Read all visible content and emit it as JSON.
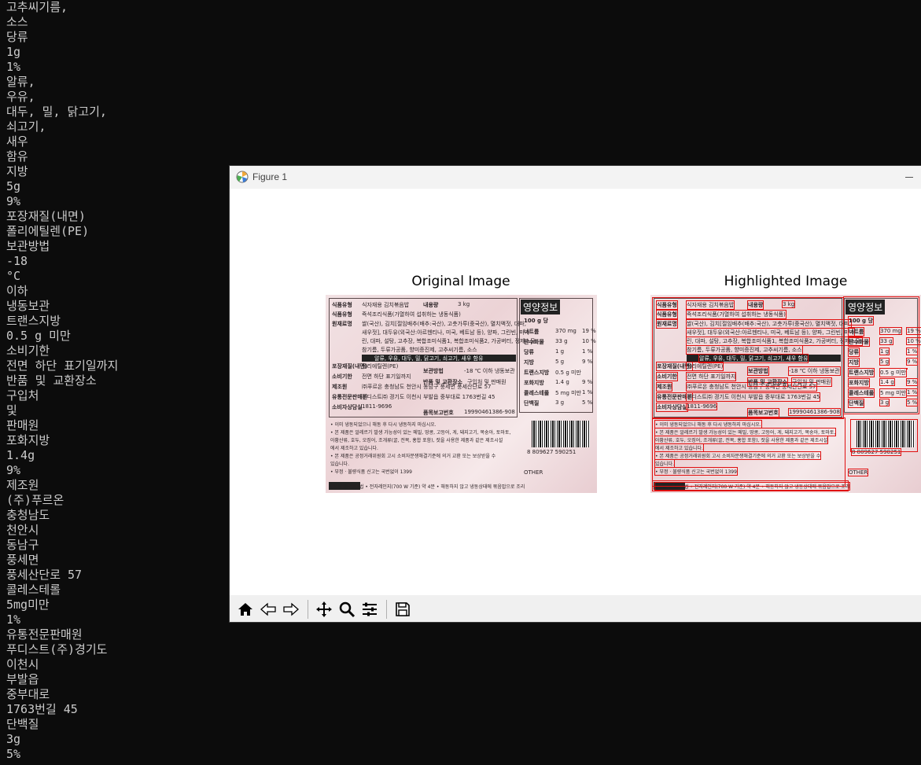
{
  "terminal": {
    "lines": [
      "고추씨기름,",
      "소스",
      "당류",
      "1g",
      "1%",
      "알류,",
      "우유,",
      "대두, 밀, 닭고기,",
      "쇠고기,",
      "새우",
      "함유",
      "지방",
      "5g",
      "9%",
      "포장재질(내면)",
      "폴리에틸렌(PE)",
      "보관방법",
      "-18",
      "°C",
      "이하",
      "냉동보관",
      "트랜스지방",
      "0.5 g 미만",
      "소비기한",
      "전면 하단 표기일까지",
      "반품 및 교환장소",
      "구입처",
      "및",
      "판매원",
      "포화지방",
      "1.4g",
      "9%",
      "제조원",
      "(주)푸르온",
      "충청남도",
      "천안시",
      "동남구",
      "풍세면",
      "풍세산단로 57",
      "콜레스테롤",
      "5mg미만",
      "1%",
      "유통전문판매원",
      "푸디스트(주)경기도",
      "이천시",
      "부발읍",
      "중부대로",
      "1763번길 45",
      "단백질",
      "3g",
      "5%"
    ]
  },
  "window": {
    "title": "Figure 1",
    "app_icon": "matplotlib-icon"
  },
  "figure": {
    "original_title": "Original Image",
    "highlighted_title": "Highlighted Image",
    "label": {
      "nutrition_title": "영양정보",
      "per_100g": "100 g 당",
      "rows": [
        {
          "k": "식품유형",
          "v": "식자재용 김치볶음밥"
        },
        {
          "k": "식품유형",
          "v": "즉석조리식품(가열하여 섭취하는 냉동식품)"
        },
        {
          "k": "원재료명",
          "v": "쌀(국산), 김치[절임배추(배추:국산), 고춧가루(중국산), 멸치액젓, 대파,"
        },
        {
          "k": "",
          "v": "새우젓], 대두유(외국산:아르헨티나, 미국, 베트남 등), 양파, 그린빈, 마가"
        },
        {
          "k": "",
          "v": "린, 대파, 설탕, 고추장, 복합조미식품1, 복합조미식품2, 가공버터, 정제소금,"
        },
        {
          "k": "",
          "v": "참기름, 두류가공품, 향미증진제, 고추씨기름, 소스"
        },
        {
          "k": "포장재질(내면)",
          "v": "폴리에틸렌(PE)"
        },
        {
          "k": "소비기한",
          "v": "전면 하단 표기일까지"
        },
        {
          "k": "제조원",
          "v": "㈜푸르온 충청남도 천안시 동남구 풍세면 풍세산단로 57"
        },
        {
          "k": "유통전문판매원",
          "v": "푸디스트㈜ 경기도 이천시 부발읍 중부대로 1763번길 45"
        },
        {
          "k": "소비자상담실",
          "v": "1811-9696"
        }
      ],
      "allergen": "알류, 우유, 대두, 밀, 닭고기, 쇠고기, 새우 함유",
      "storage_k": "보관방법",
      "storage_v": "-18 ℃ 이하 냉동보관",
      "return_k": "반품 및 교환장소",
      "return_v": "구입처 및 판매원",
      "weight_k": "내용량",
      "weight_v": "3 kg",
      "report_k": "품목보고번호",
      "report_v": "19990461386-908",
      "notes": [
        "• 이미 냉동되었으니 해동 후 다시 냉동하지 마십시오.",
        "• 본 제품은 알레르기 발생 가능성이 있는 메밀, 땅콩, 고등어, 게, 돼지고기, 복숭아, 토마토,",
        "  아황산류, 호두, 오징어, 조개류(굴, 전복, 홍합 포함), 잣을 사용한 제품과 같은 제조시설",
        "  에서 제조하고 있습니다.",
        "• 본 제품은 공정거래위원회 고시 소비자분쟁해결기준에 의거 교환 또는 보상받을 수",
        "  있습니다.",
        "• 부정 · 불량식품 신고는 국번없이 1399"
      ],
      "cooking": "해동 및 조리방법 • 전자레인지(700 W 기준) 약 4분 • 해동하지 않고 냉동상태에 볶음밥으로 조리",
      "nutrients": [
        {
          "k": "나트륨",
          "v": "370 mg",
          "p": "19 %"
        },
        {
          "k": "탄수화물",
          "v": "33 g",
          "p": "10 %"
        },
        {
          "k": "당류",
          "v": "1 g",
          "p": "1 %"
        },
        {
          "k": "지방",
          "v": "5 g",
          "p": "9 %"
        },
        {
          "k": "트랜스지방",
          "v": "0.5 g 미만",
          "p": ""
        },
        {
          "k": "포화지방",
          "v": "1.4 g",
          "p": "9 %"
        },
        {
          "k": "콜레스테롤",
          "v": "5 mg 미만",
          "p": "1 %"
        },
        {
          "k": "단백질",
          "v": "3 g",
          "p": "5 %"
        }
      ],
      "barcode": "8 809627 590251",
      "recycle": "OTHER"
    }
  },
  "toolbar": {
    "buttons": [
      {
        "name": "home-button",
        "icon": "home-icon"
      },
      {
        "name": "back-button",
        "icon": "back-arrow-icon"
      },
      {
        "name": "forward-button",
        "icon": "forward-arrow-icon"
      },
      {
        "name": "pan-button",
        "icon": "move-icon"
      },
      {
        "name": "zoom-button",
        "icon": "zoom-icon"
      },
      {
        "name": "configure-subplots-button",
        "icon": "sliders-icon"
      },
      {
        "name": "save-button",
        "icon": "save-icon"
      }
    ]
  }
}
